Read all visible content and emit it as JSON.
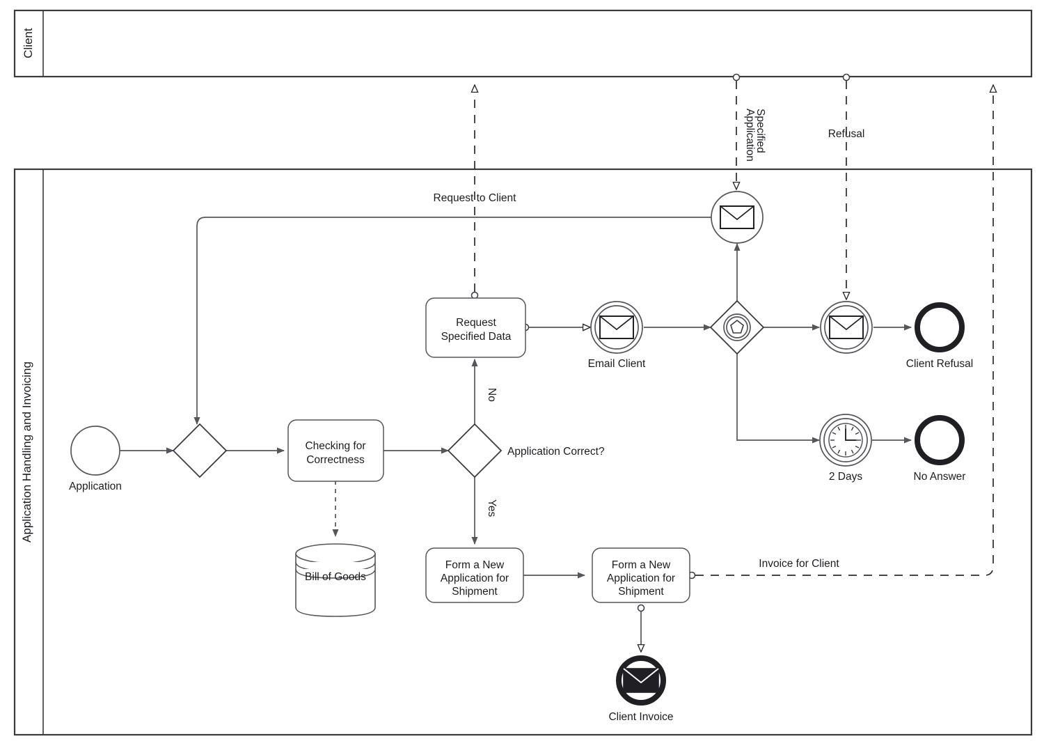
{
  "diagram": {
    "type": "bpmn-process-diagram",
    "title": "Application Handling and Invoicing",
    "pools": [
      {
        "id": "client",
        "label": "Client"
      },
      {
        "id": "main",
        "label": "Application Handling and Invoicing"
      }
    ]
  },
  "nodes": {
    "start_application": {
      "label": "Application",
      "type": "start-event"
    },
    "gateway_merge": {
      "label": "",
      "type": "exclusive-gateway"
    },
    "task_checking": {
      "label": "Checking for\nCorrectness",
      "line1": "Checking for",
      "line2": "Correctness",
      "type": "task"
    },
    "data_bill_of_goods": {
      "label": "Bill of Goods",
      "type": "data-store"
    },
    "gateway_correct": {
      "label": "Application Correct?",
      "type": "exclusive-gateway"
    },
    "task_request_data": {
      "label": "Request\nSpecified Data",
      "line1": "Request",
      "line2": "Specified Data",
      "type": "task"
    },
    "event_email_client": {
      "label": "Email Client",
      "type": "message-intermediate-throw-event"
    },
    "gateway_event_based": {
      "label": "",
      "type": "event-based-gateway"
    },
    "event_msg_refusal": {
      "label": "",
      "type": "message-intermediate-catch-event"
    },
    "end_client_refusal": {
      "label": "Client Refusal",
      "type": "end-event"
    },
    "event_timer_2days": {
      "label": "2 Days",
      "type": "timer-intermediate-catch-event"
    },
    "end_no_answer": {
      "label": "No Answer",
      "type": "end-event"
    },
    "event_msg_specified": {
      "label": "",
      "type": "message-intermediate-catch-event"
    },
    "task_form_app_1": {
      "label": "Form a New\nApplication for\nShipment",
      "line1": "Form a New",
      "line2": "Application for",
      "line3": "Shipment",
      "type": "task"
    },
    "task_form_app_2": {
      "label": "Form a New\nApplication for\nShipment",
      "line1": "Form a New",
      "line2": "Application for",
      "line3": "Shipment",
      "type": "task"
    },
    "end_client_invoice": {
      "label": "Client Invoice",
      "type": "message-end-event"
    }
  },
  "flow_labels": {
    "request_to_client": "Request to Client",
    "specified_application": "Specified Application",
    "specified_application_l1": "Specified",
    "specified_application_l2": "Application",
    "refusal": "Refusal",
    "invoice_for_client": "Invoice for Client",
    "gateway_no": "No",
    "gateway_yes": "Yes"
  },
  "colors": {
    "stroke": "#55555b",
    "pool_stroke": "#3b3b3b",
    "text": "#1c1c22",
    "end_event": "#201f24",
    "background": "#ffffff"
  }
}
